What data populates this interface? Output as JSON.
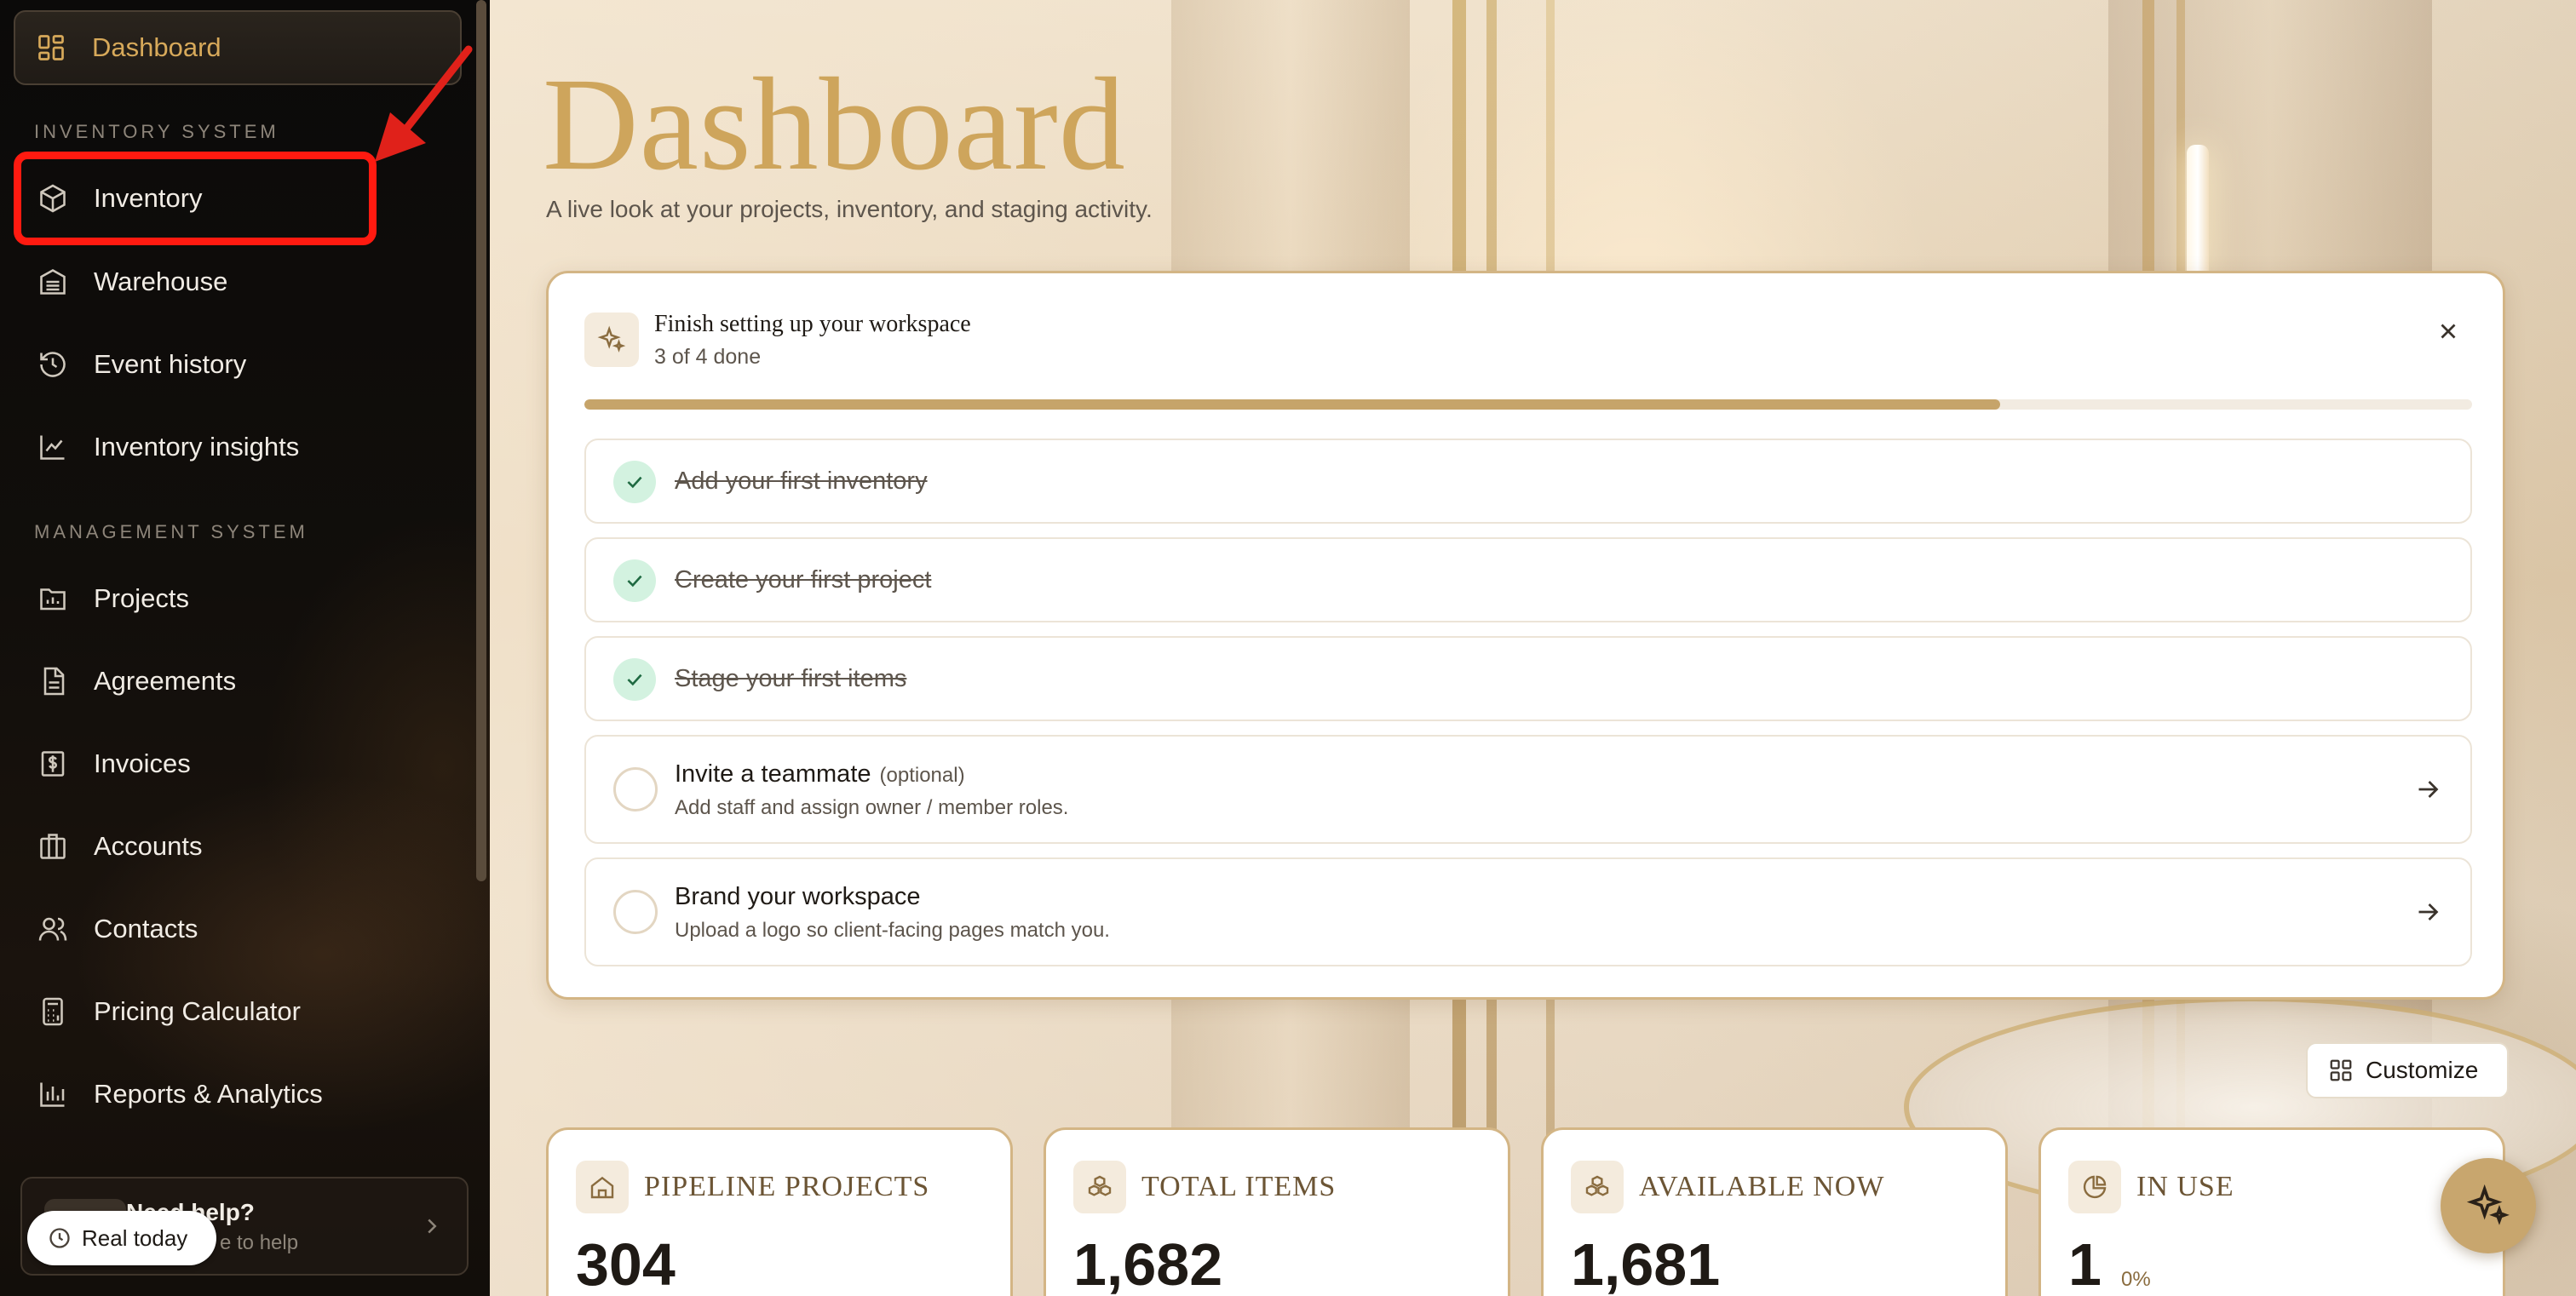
{
  "sidebar": {
    "dashboard_label": "Dashboard",
    "inventory_section": "INVENTORY SYSTEM",
    "management_section": "MANAGEMENT SYSTEM",
    "items": [
      {
        "label": "Inventory",
        "icon": "cube-icon"
      },
      {
        "label": "Warehouse",
        "icon": "warehouse-icon"
      },
      {
        "label": "Event history",
        "icon": "history-icon"
      },
      {
        "label": "Inventory insights",
        "icon": "line-chart-icon"
      },
      {
        "label": "Projects",
        "icon": "folder-chart-icon"
      },
      {
        "label": "Agreements",
        "icon": "document-icon"
      },
      {
        "label": "Invoices",
        "icon": "dollar-receipt-icon"
      },
      {
        "label": "Accounts",
        "icon": "building-icon"
      },
      {
        "label": "Contacts",
        "icon": "users-icon"
      },
      {
        "label": "Pricing Calculator",
        "icon": "calculator-icon"
      },
      {
        "label": "Reports & Analytics",
        "icon": "bar-chart-icon"
      }
    ],
    "help": {
      "title": "Need help?",
      "subtitle": "e to help"
    },
    "real_today_label": "Real today"
  },
  "header": {
    "title": "Dashboard",
    "subtitle": "A live look at your projects, inventory, and staging activity."
  },
  "setup": {
    "title": "Finish setting up your workspace",
    "count": "3 of 4 done",
    "progress_fraction": 0.75,
    "done_tasks": [
      {
        "label": "Add your first inventory"
      },
      {
        "label": "Create your first project"
      },
      {
        "label": "Stage your first items"
      }
    ],
    "open_tasks": [
      {
        "label": "Invite a teammate",
        "optional": "(optional)",
        "desc": "Add staff and assign owner / member roles."
      },
      {
        "label": "Brand your workspace",
        "optional": "",
        "desc": "Upload a logo so client-facing pages match you."
      }
    ]
  },
  "customize_label": "Customize",
  "stats": [
    {
      "label": "PIPELINE PROJECTS",
      "value": "304",
      "extra": ""
    },
    {
      "label": "TOTAL ITEMS",
      "value": "1,682",
      "extra": ""
    },
    {
      "label": "AVAILABLE NOW",
      "value": "1,681",
      "extra": ""
    },
    {
      "label": "IN USE",
      "value": "1",
      "extra": "0%"
    }
  ],
  "colors": {
    "accent": "#cea55c",
    "highlight": "#ff1a10",
    "success_bg": "#d3f2e0"
  }
}
